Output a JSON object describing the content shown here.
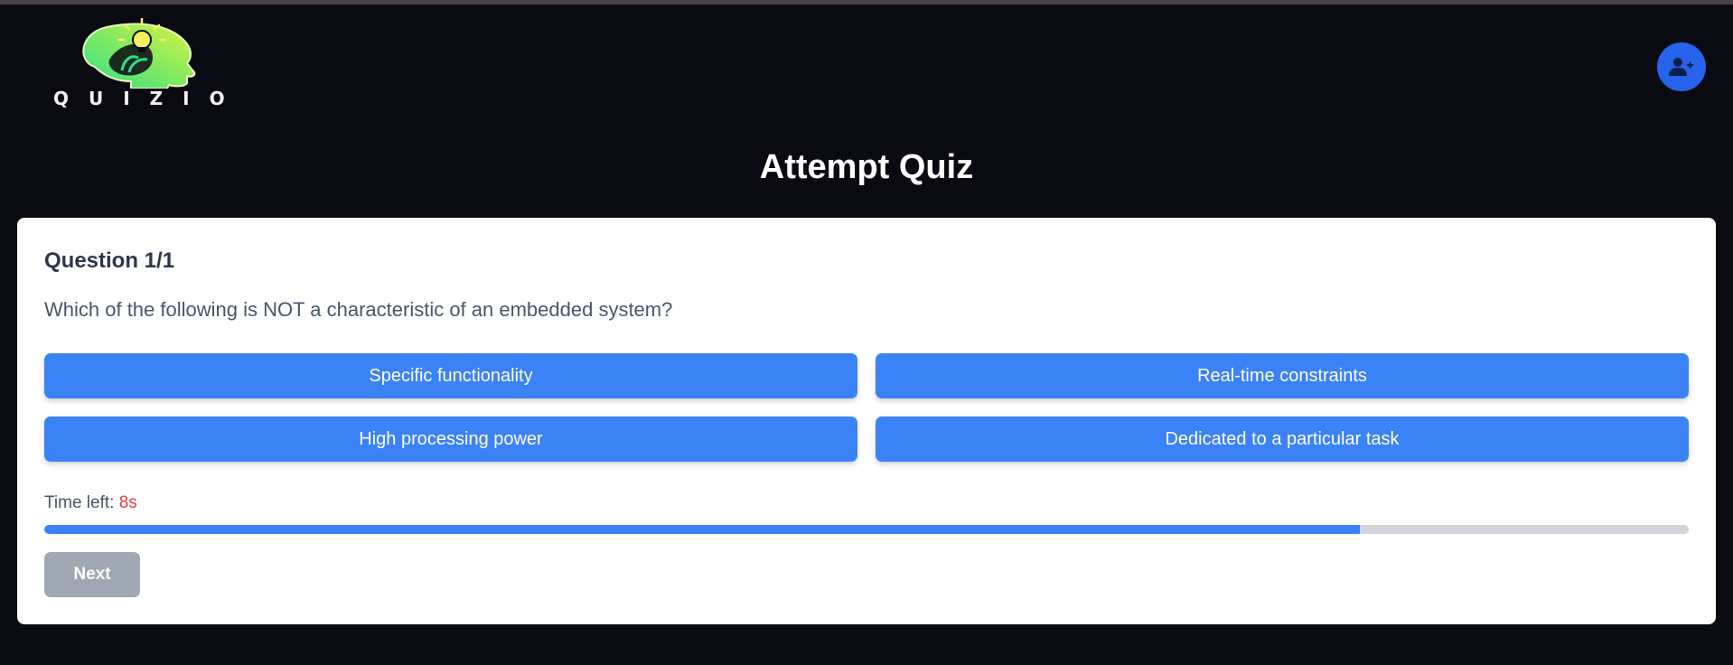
{
  "brand": {
    "logo_text": "QUIZIO",
    "icon": "lightbulb-head-icon"
  },
  "header": {
    "profile_icon": "user-plus-icon"
  },
  "page": {
    "title": "Attempt Quiz"
  },
  "quiz": {
    "counter": "Question 1/1",
    "question": "Which of the following is NOT a characteristic of an embedded system?",
    "options": [
      "Specific functionality",
      "Real-time constraints",
      "High processing power",
      "Dedicated to a particular task"
    ],
    "timer_label": "Time left: ",
    "timer_value": "8s",
    "progress_fraction": 0.8,
    "next_label": "Next"
  },
  "colors": {
    "accent": "#3b82f6",
    "avatar": "#2563eb",
    "timer": "#e53e3e",
    "disabled": "#a0a7b4",
    "background": "#0a0b12",
    "logo_gradient": [
      "#2de08a",
      "#d8f33b"
    ]
  }
}
